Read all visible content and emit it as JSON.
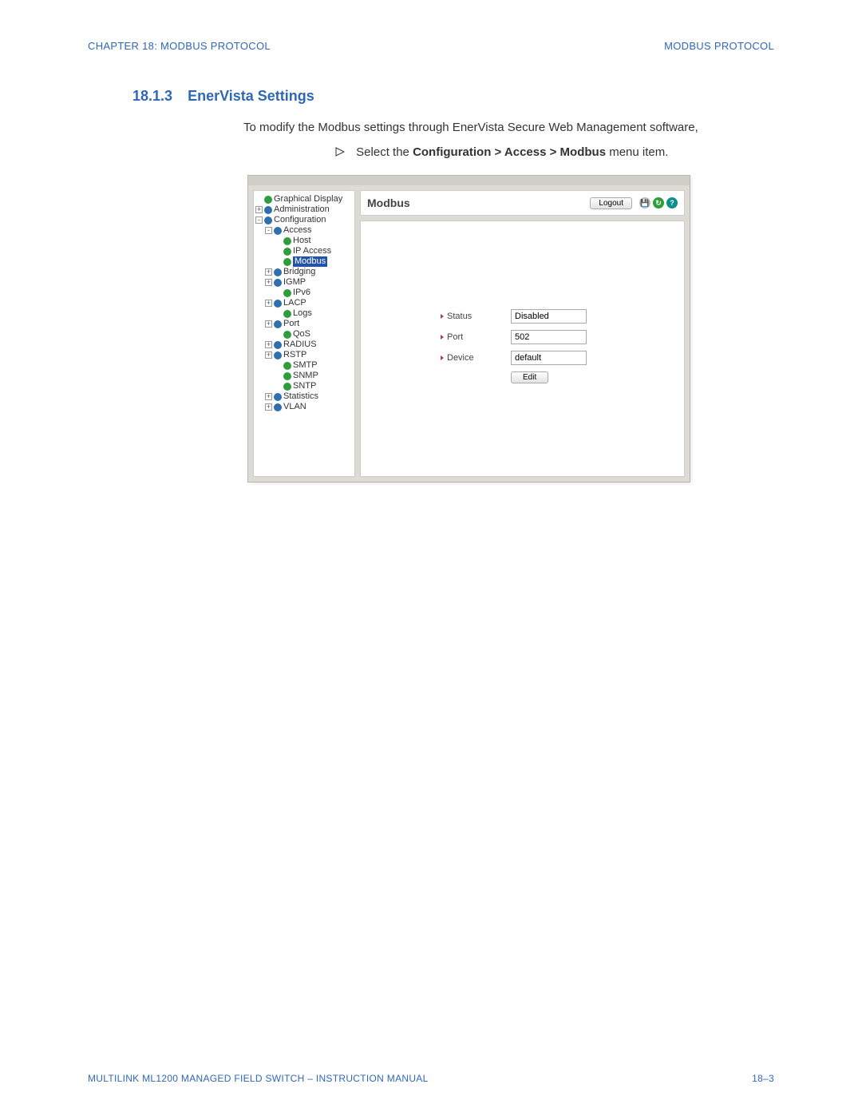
{
  "header": {
    "left": "CHAPTER 18: MODBUS PROTOCOL",
    "right": "MODBUS PROTOCOL"
  },
  "section": {
    "number": "18.1.3",
    "title": "EnerVista Settings",
    "body": "To modify the Modbus settings through EnerVista Secure Web Management software,",
    "step_prefix": "Select the ",
    "step_bold": "Configuration > Access > Modbus",
    "step_suffix": " menu item."
  },
  "screenshot": {
    "panel_title": "Modbus",
    "logout": "Logout",
    "tree": [
      {
        "indent": 0,
        "exp": "",
        "color": "green",
        "label": "Graphical Display"
      },
      {
        "indent": 0,
        "exp": "+",
        "color": "blue",
        "label": "Administration"
      },
      {
        "indent": 0,
        "exp": "-",
        "color": "blue",
        "label": "Configuration"
      },
      {
        "indent": 1,
        "exp": "-",
        "color": "blue",
        "label": "Access"
      },
      {
        "indent": 2,
        "exp": "",
        "color": "green",
        "label": "Host"
      },
      {
        "indent": 2,
        "exp": "",
        "color": "green",
        "label": "IP Access"
      },
      {
        "indent": 2,
        "exp": "",
        "color": "green",
        "label": "Modbus",
        "selected": true
      },
      {
        "indent": 1,
        "exp": "+",
        "color": "blue",
        "label": "Bridging"
      },
      {
        "indent": 1,
        "exp": "+",
        "color": "blue",
        "label": "IGMP"
      },
      {
        "indent": 2,
        "exp": "",
        "color": "green",
        "label": "IPv6"
      },
      {
        "indent": 1,
        "exp": "+",
        "color": "blue",
        "label": "LACP"
      },
      {
        "indent": 2,
        "exp": "",
        "color": "green",
        "label": "Logs"
      },
      {
        "indent": 1,
        "exp": "+",
        "color": "blue",
        "label": "Port"
      },
      {
        "indent": 2,
        "exp": "",
        "color": "green",
        "label": "QoS"
      },
      {
        "indent": 1,
        "exp": "+",
        "color": "blue",
        "label": "RADIUS"
      },
      {
        "indent": 1,
        "exp": "+",
        "color": "blue",
        "label": "RSTP"
      },
      {
        "indent": 2,
        "exp": "",
        "color": "green",
        "label": "SMTP"
      },
      {
        "indent": 2,
        "exp": "",
        "color": "green",
        "label": "SNMP"
      },
      {
        "indent": 2,
        "exp": "",
        "color": "green",
        "label": "SNTP"
      },
      {
        "indent": 1,
        "exp": "+",
        "color": "blue",
        "label": "Statistics"
      },
      {
        "indent": 1,
        "exp": "+",
        "color": "blue",
        "label": "VLAN"
      }
    ],
    "form": {
      "rows": [
        {
          "label": "Status",
          "value": "Disabled"
        },
        {
          "label": "Port",
          "value": "502"
        },
        {
          "label": "Device",
          "value": "default"
        }
      ],
      "edit": "Edit"
    },
    "icons": {
      "save": "💾",
      "refresh": "↻",
      "help": "?"
    }
  },
  "footer": {
    "left": "MULTILINK ML1200 MANAGED FIELD SWITCH – INSTRUCTION MANUAL",
    "right": "18–3"
  }
}
